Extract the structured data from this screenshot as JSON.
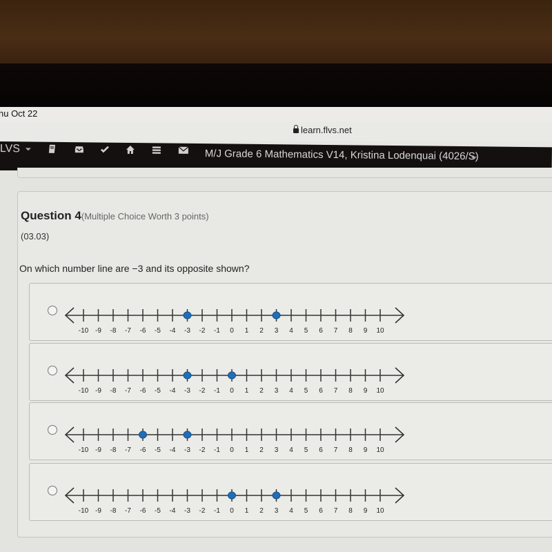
{
  "status_bar": {
    "time_text": "hu Oct 22"
  },
  "browser": {
    "url": "learn.flvs.net"
  },
  "navbar": {
    "brand": "LVS",
    "icons": [
      "book-icon",
      "inbox-icon",
      "checkmark-icon",
      "home-icon",
      "menu-icon",
      "envelope-icon"
    ],
    "course_title": "M/J Grade 6 Mathematics V14, Kristina Lodenquai (4026/S)"
  },
  "question": {
    "title": "Question 4",
    "subtitle": "(Multiple Choice Worth 3 points)",
    "code": "(03.03)",
    "prompt": "On which number line are −3 and its opposite shown?"
  },
  "number_line": {
    "min": -10,
    "max": 10,
    "tick_labels": [
      "-10",
      "-9",
      "-8",
      "-7",
      "-6",
      "-5",
      "-4",
      "-3",
      "-2",
      "-1",
      "0",
      "1",
      "2",
      "3",
      "4",
      "5",
      "6",
      "7",
      "8",
      "9",
      "10"
    ],
    "point_color": "#1f6fb8"
  },
  "options": [
    {
      "points": [
        -3,
        3
      ],
      "selected": false
    },
    {
      "points": [
        -3,
        0
      ],
      "selected": false
    },
    {
      "points": [
        -6,
        -3
      ],
      "selected": false
    },
    {
      "points": [
        0,
        3
      ],
      "selected": false
    }
  ]
}
